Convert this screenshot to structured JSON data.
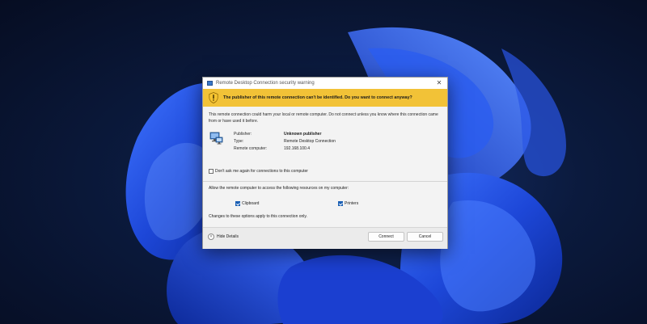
{
  "window": {
    "title": "Remote Desktop Connection security warning",
    "close_glyph": "✕"
  },
  "banner": {
    "icon": "shield-warning-icon",
    "text": "The publisher of this remote connection can't be identified. Do you want to connect anyway?"
  },
  "body": {
    "warning": "This remote connection could harm your local or remote computer. Do not connect unless you know where this connection came from or have used it before."
  },
  "details": {
    "icon": "remote-computer-icon",
    "publisher_label": "Publisher:",
    "publisher_value": "Unknown publisher",
    "type_label": "Type:",
    "type_value": "Remote Desktop Connection",
    "computer_label": "Remote computer:",
    "computer_value": "192.168.100.4"
  },
  "options": {
    "dont_ask_label": "Don't ask me again for connections to this computer",
    "dont_ask_checked": false,
    "allow_text": "Allow the remote computer to access the following resources on my computer:",
    "clipboard_label": "Clipboard",
    "clipboard_checked": true,
    "printers_label": "Printers",
    "printers_checked": true,
    "changes_text": "Changes to these options apply to this connection only."
  },
  "footer": {
    "hide_details_label": "Hide Details",
    "connect_label": "Connect",
    "cancel_label": "Cancel"
  },
  "colors": {
    "banner": "#f2c237",
    "accent": "#1a5fb4",
    "wallpaper_blue": "#1f4fe0"
  }
}
